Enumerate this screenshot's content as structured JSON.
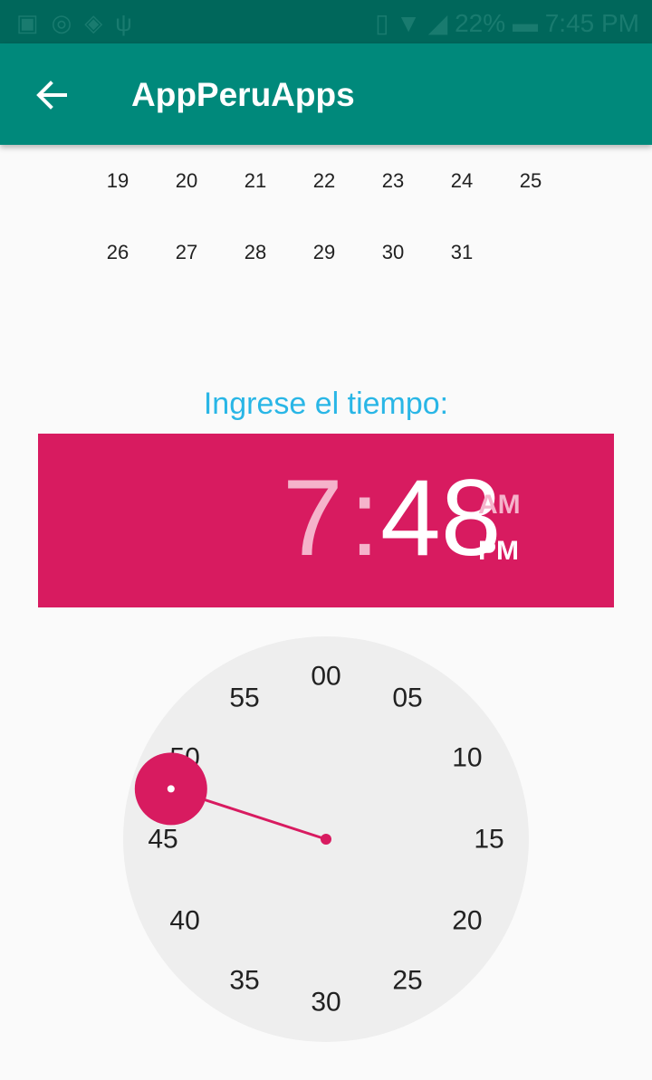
{
  "status_bar": {
    "left_icons": [
      "gallery-icon",
      "sync-icon",
      "shield-icon",
      "usb-icon"
    ],
    "battery": "22%",
    "time": "7:45 PM"
  },
  "app_bar": {
    "title": "AppPeruApps"
  },
  "calendar": {
    "rows": [
      [
        "19",
        "20",
        "21",
        "22",
        "23",
        "24",
        "25"
      ],
      [
        "26",
        "27",
        "28",
        "29",
        "30",
        "31"
      ]
    ]
  },
  "time_picker": {
    "label": "Ingrese el tiempo:",
    "hour": "7",
    "separator": ":",
    "minute": "48",
    "am": "AM",
    "pm": "PM",
    "selected_period": "PM",
    "accent_color": "#d81b60",
    "dial_labels": [
      "00",
      "05",
      "10",
      "15",
      "20",
      "25",
      "30",
      "35",
      "40",
      "45",
      "50",
      "55"
    ],
    "selected_minute": 48
  }
}
